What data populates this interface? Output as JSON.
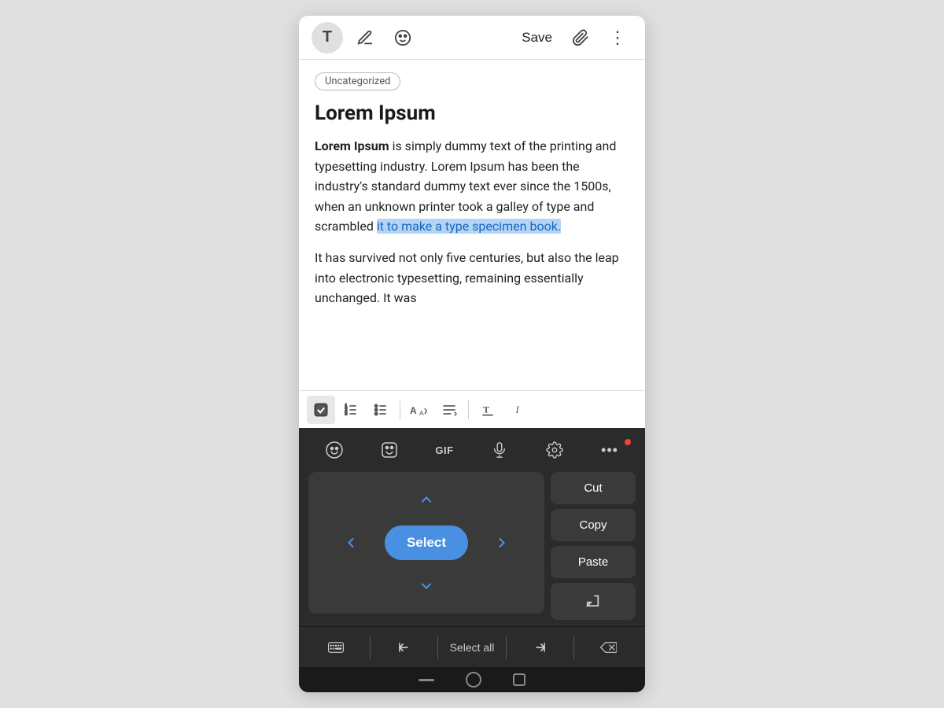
{
  "toolbar": {
    "t_label": "T",
    "save_label": "Save",
    "attach_icon": "📎",
    "more_icon": "⋮"
  },
  "content": {
    "category": "Uncategorized",
    "title": "Lorem Ipsum",
    "body_bold": "Lorem Ipsum",
    "body_before_select": " is simply dummy text of the printing and typesetting industry. Lorem Ipsum has been the industry's standard dummy text ever since the 1500s, when an unknown printer took a galley of type and scrambled ",
    "body_selected": "it to make a type specimen book.",
    "body_para2": "It has survived not only five centuries, but also the leap into electronic typesetting, remaining essentially unchanged. It was"
  },
  "format_toolbar": {
    "check_icon": "✓",
    "ordered_list_icon": "≡",
    "unordered_list_icon": "≡",
    "font_size_icon": "A",
    "align_icon": "≡",
    "text_format_icon": "T",
    "more_icon": "I"
  },
  "keyboard": {
    "emoji_icon": "😊",
    "sticker_icon": "🙂",
    "gif_label": "GIF",
    "mic_icon": "🎤",
    "settings_icon": "⚙",
    "more_icon": "•••",
    "nav": {
      "up": "∧",
      "down": "∨",
      "left": "‹",
      "right": "›",
      "select_label": "Select"
    },
    "actions": {
      "cut": "Cut",
      "copy": "Copy",
      "paste": "Paste",
      "enter": "↵"
    },
    "bottom": {
      "keyboard_icon": "⌨",
      "first_icon": "⏮",
      "select_all": "Select all",
      "last_icon": "⏭",
      "delete_icon": "⌫"
    }
  }
}
